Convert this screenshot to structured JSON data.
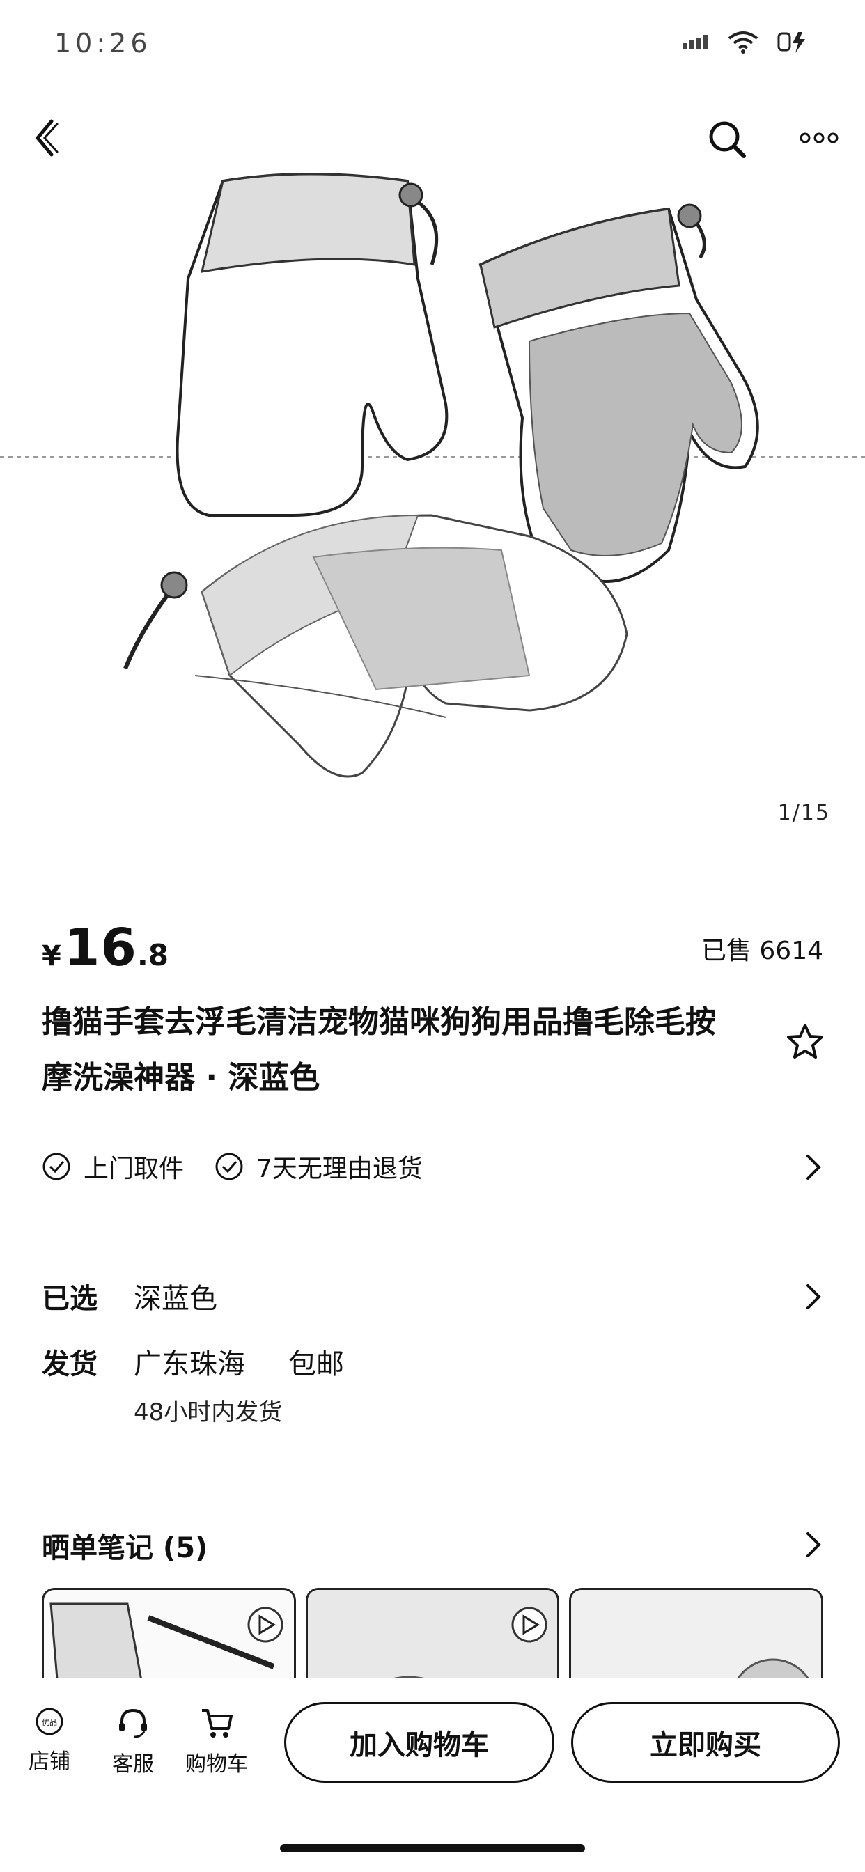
{
  "status_bar": {
    "time": "10:26"
  },
  "gallery": {
    "pager": "1/15"
  },
  "product": {
    "currency": "¥",
    "price_int": "16",
    "price_dec": ".8",
    "sold": "已售 6614",
    "title": "撸猫手套去浮毛清洁宠物猫咪狗狗用品撸毛除毛按摩洗澡神器 · 深蓝色"
  },
  "services": [
    {
      "label": "上门取件"
    },
    {
      "label": "7天无理由退货"
    }
  ],
  "selection": {
    "label": "已选",
    "value": "深蓝色"
  },
  "shipping": {
    "label": "发货",
    "location": "广东珠海",
    "fee": "包邮",
    "eta": "48小时内发货"
  },
  "notes": {
    "title": "晒单笔记 (5)"
  },
  "bottom_bar": {
    "store": "店铺",
    "service": "客服",
    "cart": "购物车",
    "add_to_cart": "加入购物车",
    "buy_now": "立即购买",
    "store_logo_text": "优品"
  },
  "icons": [
    "back-icon",
    "search-icon",
    "more-icon",
    "star-icon",
    "check-circle-icon",
    "chevron-right-icon",
    "play-icon",
    "store-icon",
    "headset-icon",
    "cart-icon",
    "wifi-icon",
    "battery-icon",
    "signal-icon"
  ],
  "colors": {
    "primary": "#111111",
    "background": "#ffffff"
  }
}
